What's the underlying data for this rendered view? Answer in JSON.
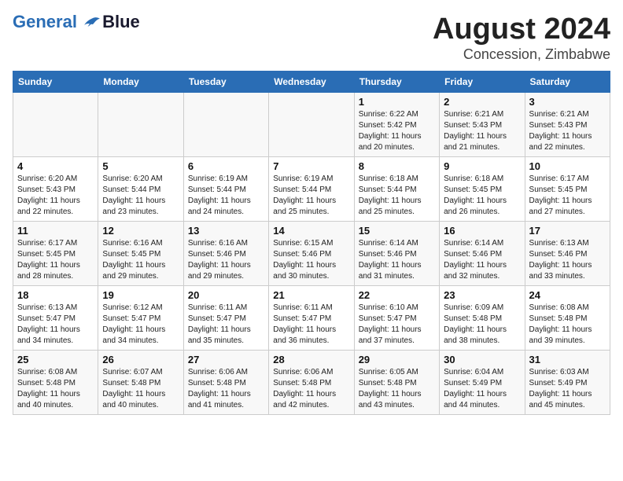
{
  "logo": {
    "line1": "General",
    "line2": "Blue"
  },
  "title": "August 2024",
  "subtitle": "Concession, Zimbabwe",
  "days_of_week": [
    "Sunday",
    "Monday",
    "Tuesday",
    "Wednesday",
    "Thursday",
    "Friday",
    "Saturday"
  ],
  "weeks": [
    [
      {
        "day": "",
        "info": ""
      },
      {
        "day": "",
        "info": ""
      },
      {
        "day": "",
        "info": ""
      },
      {
        "day": "",
        "info": ""
      },
      {
        "day": "1",
        "info": "Sunrise: 6:22 AM\nSunset: 5:42 PM\nDaylight: 11 hours and 20 minutes."
      },
      {
        "day": "2",
        "info": "Sunrise: 6:21 AM\nSunset: 5:43 PM\nDaylight: 11 hours and 21 minutes."
      },
      {
        "day": "3",
        "info": "Sunrise: 6:21 AM\nSunset: 5:43 PM\nDaylight: 11 hours and 22 minutes."
      }
    ],
    [
      {
        "day": "4",
        "info": "Sunrise: 6:20 AM\nSunset: 5:43 PM\nDaylight: 11 hours and 22 minutes."
      },
      {
        "day": "5",
        "info": "Sunrise: 6:20 AM\nSunset: 5:44 PM\nDaylight: 11 hours and 23 minutes."
      },
      {
        "day": "6",
        "info": "Sunrise: 6:19 AM\nSunset: 5:44 PM\nDaylight: 11 hours and 24 minutes."
      },
      {
        "day": "7",
        "info": "Sunrise: 6:19 AM\nSunset: 5:44 PM\nDaylight: 11 hours and 25 minutes."
      },
      {
        "day": "8",
        "info": "Sunrise: 6:18 AM\nSunset: 5:44 PM\nDaylight: 11 hours and 25 minutes."
      },
      {
        "day": "9",
        "info": "Sunrise: 6:18 AM\nSunset: 5:45 PM\nDaylight: 11 hours and 26 minutes."
      },
      {
        "day": "10",
        "info": "Sunrise: 6:17 AM\nSunset: 5:45 PM\nDaylight: 11 hours and 27 minutes."
      }
    ],
    [
      {
        "day": "11",
        "info": "Sunrise: 6:17 AM\nSunset: 5:45 PM\nDaylight: 11 hours and 28 minutes."
      },
      {
        "day": "12",
        "info": "Sunrise: 6:16 AM\nSunset: 5:45 PM\nDaylight: 11 hours and 29 minutes."
      },
      {
        "day": "13",
        "info": "Sunrise: 6:16 AM\nSunset: 5:46 PM\nDaylight: 11 hours and 29 minutes."
      },
      {
        "day": "14",
        "info": "Sunrise: 6:15 AM\nSunset: 5:46 PM\nDaylight: 11 hours and 30 minutes."
      },
      {
        "day": "15",
        "info": "Sunrise: 6:14 AM\nSunset: 5:46 PM\nDaylight: 11 hours and 31 minutes."
      },
      {
        "day": "16",
        "info": "Sunrise: 6:14 AM\nSunset: 5:46 PM\nDaylight: 11 hours and 32 minutes."
      },
      {
        "day": "17",
        "info": "Sunrise: 6:13 AM\nSunset: 5:46 PM\nDaylight: 11 hours and 33 minutes."
      }
    ],
    [
      {
        "day": "18",
        "info": "Sunrise: 6:13 AM\nSunset: 5:47 PM\nDaylight: 11 hours and 34 minutes."
      },
      {
        "day": "19",
        "info": "Sunrise: 6:12 AM\nSunset: 5:47 PM\nDaylight: 11 hours and 34 minutes."
      },
      {
        "day": "20",
        "info": "Sunrise: 6:11 AM\nSunset: 5:47 PM\nDaylight: 11 hours and 35 minutes."
      },
      {
        "day": "21",
        "info": "Sunrise: 6:11 AM\nSunset: 5:47 PM\nDaylight: 11 hours and 36 minutes."
      },
      {
        "day": "22",
        "info": "Sunrise: 6:10 AM\nSunset: 5:47 PM\nDaylight: 11 hours and 37 minutes."
      },
      {
        "day": "23",
        "info": "Sunrise: 6:09 AM\nSunset: 5:48 PM\nDaylight: 11 hours and 38 minutes."
      },
      {
        "day": "24",
        "info": "Sunrise: 6:08 AM\nSunset: 5:48 PM\nDaylight: 11 hours and 39 minutes."
      }
    ],
    [
      {
        "day": "25",
        "info": "Sunrise: 6:08 AM\nSunset: 5:48 PM\nDaylight: 11 hours and 40 minutes."
      },
      {
        "day": "26",
        "info": "Sunrise: 6:07 AM\nSunset: 5:48 PM\nDaylight: 11 hours and 40 minutes."
      },
      {
        "day": "27",
        "info": "Sunrise: 6:06 AM\nSunset: 5:48 PM\nDaylight: 11 hours and 41 minutes."
      },
      {
        "day": "28",
        "info": "Sunrise: 6:06 AM\nSunset: 5:48 PM\nDaylight: 11 hours and 42 minutes."
      },
      {
        "day": "29",
        "info": "Sunrise: 6:05 AM\nSunset: 5:48 PM\nDaylight: 11 hours and 43 minutes."
      },
      {
        "day": "30",
        "info": "Sunrise: 6:04 AM\nSunset: 5:49 PM\nDaylight: 11 hours and 44 minutes."
      },
      {
        "day": "31",
        "info": "Sunrise: 6:03 AM\nSunset: 5:49 PM\nDaylight: 11 hours and 45 minutes."
      }
    ]
  ]
}
